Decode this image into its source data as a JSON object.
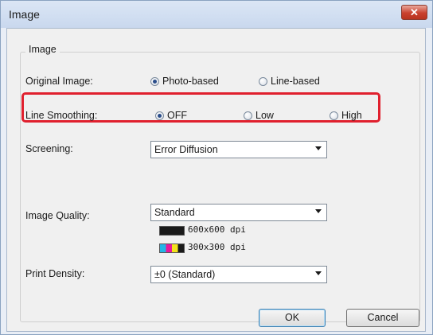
{
  "window": {
    "title": "Image",
    "close_label": "✕"
  },
  "group": {
    "label": "Image"
  },
  "original_image": {
    "label": "Original Image:",
    "options": [
      {
        "label": "Photo-based",
        "selected": true
      },
      {
        "label": "Line-based",
        "selected": false
      }
    ]
  },
  "line_smoothing": {
    "label": "Line Smoothing:",
    "options": [
      {
        "label": "OFF",
        "selected": true
      },
      {
        "label": "Low",
        "selected": false
      },
      {
        "label": "High",
        "selected": false
      }
    ]
  },
  "screening": {
    "label": "Screening:",
    "value": "Error Diffusion"
  },
  "image_quality": {
    "label": "Image Quality:",
    "value": "Standard",
    "mono_dpi": "600x600 dpi",
    "color_dpi": "300x300 dpi"
  },
  "print_density": {
    "label": "Print Density:",
    "value": "±0 (Standard)"
  },
  "buttons": {
    "ok": "OK",
    "cancel": "Cancel"
  },
  "colors": {
    "highlight": "#e0202e",
    "close": "#c9412e"
  }
}
